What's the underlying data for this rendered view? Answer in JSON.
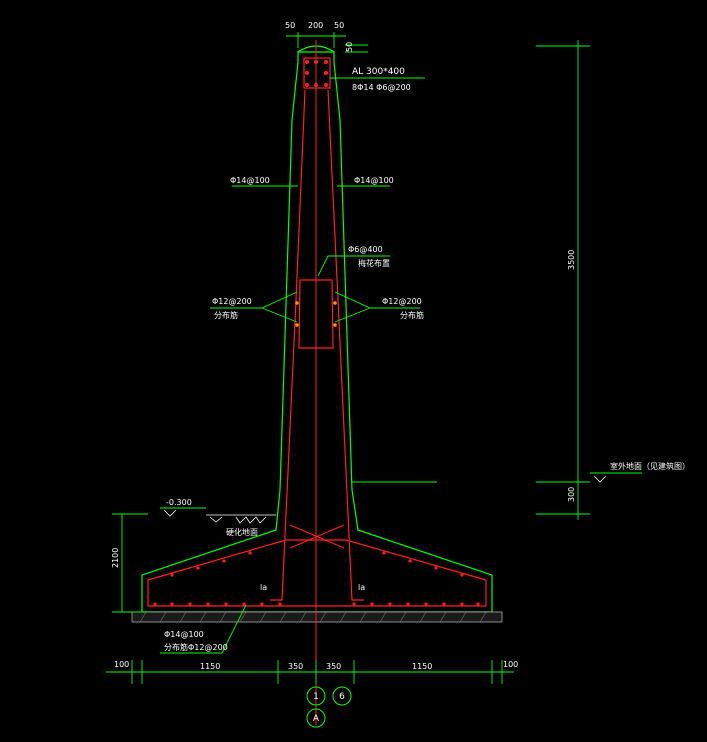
{
  "dims_top": {
    "left": "50",
    "mid": "200",
    "right": "50",
    "cover": "50"
  },
  "cap_beam": {
    "size": "AL 300*400",
    "bars": "8Φ14  Φ6@200"
  },
  "stem_bars": {
    "left": "Φ14@100",
    "right": "Φ14@100"
  },
  "tie_bar": {
    "spec": "Φ6@400",
    "note": "梅花布置"
  },
  "dist_bars": {
    "left_spec": "Φ12@200",
    "left_note": "分布筋",
    "right_spec": "Φ12@200",
    "right_note": "分布筋"
  },
  "elevation": {
    "level": "-0.300",
    "ground_label": "硬化地面"
  },
  "right_ground": {
    "label": "室外地面（见建筑图）"
  },
  "dims_vertical": {
    "stem_height": "3500",
    "below_ground": "300",
    "footing_height": "2100"
  },
  "footing_bars": {
    "main": "Φ14@100",
    "dist": "分布筋Φ12@200",
    "la_left": "la",
    "la_right": "la"
  },
  "dims_bottom": [
    "100",
    "1150",
    "350",
    "350",
    "1150",
    "100"
  ],
  "axes": {
    "a": "1",
    "b": "6",
    "c": "A"
  },
  "colors": {
    "background": "#000000",
    "concrete_outline": "#00ff00",
    "rebar": "#ff2020",
    "dimension": "#00ff00",
    "text": "#ffffff",
    "marker": "#ff9900"
  }
}
